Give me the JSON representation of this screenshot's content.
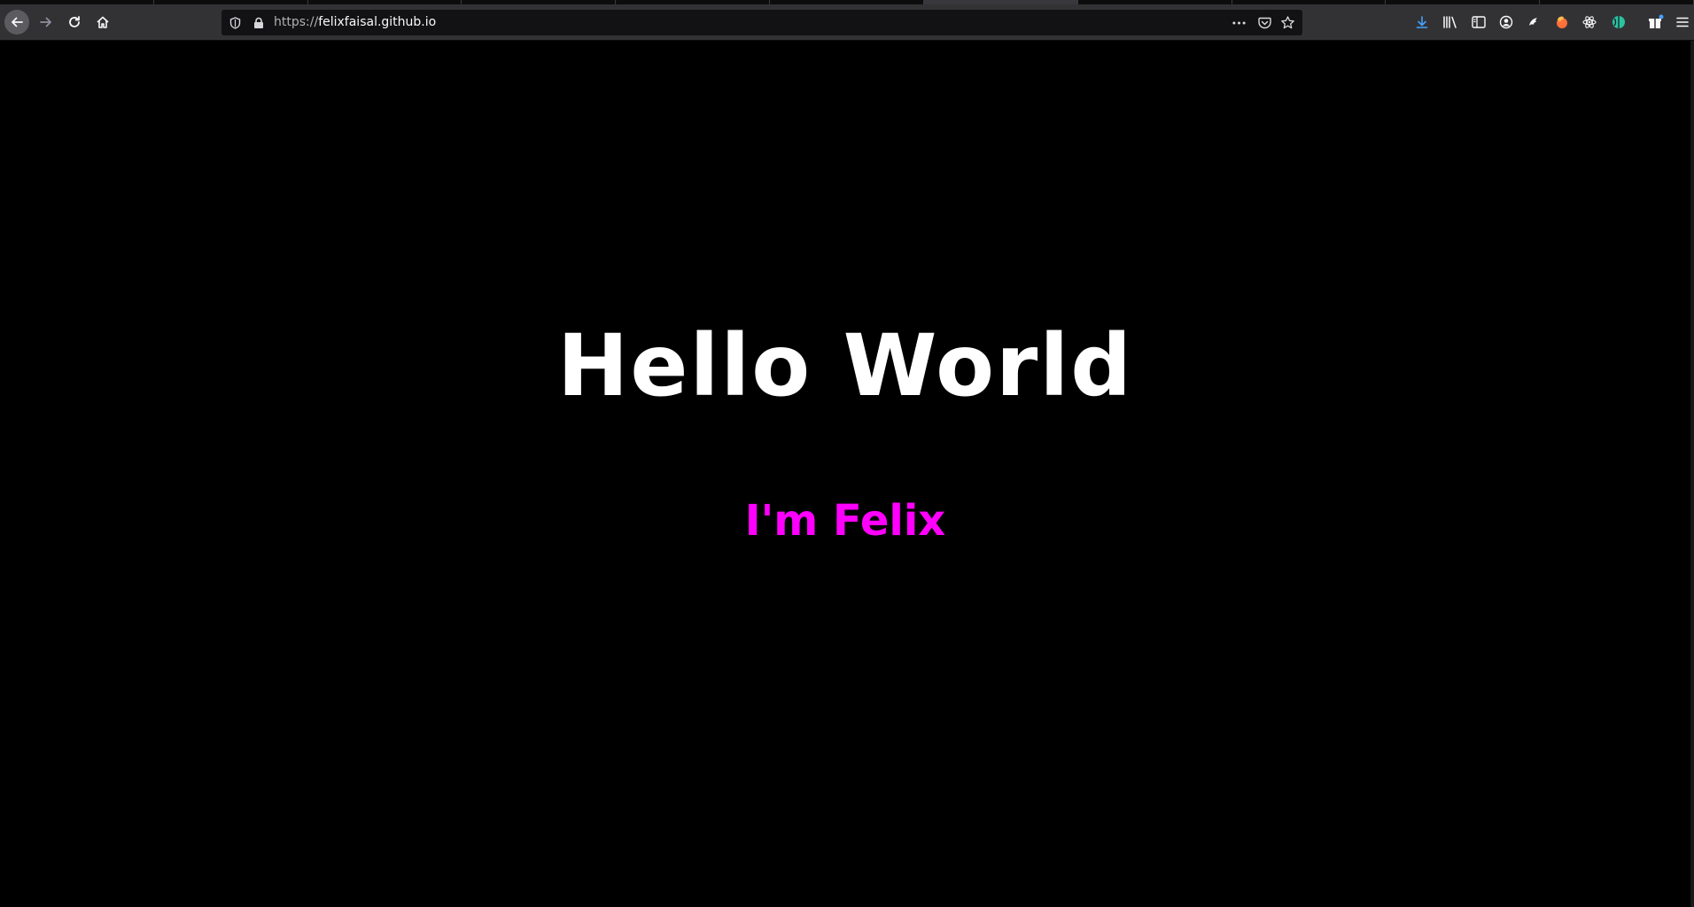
{
  "browser": {
    "url_protocol": "https://",
    "url_host": "felixfaisal.github.io",
    "icons": {
      "back": "back-arrow-icon",
      "forward": "forward-arrow-icon",
      "reload": "reload-icon",
      "home": "home-icon",
      "tracking": "shield-icon",
      "lock": "lock-icon",
      "page_actions": "more-icon",
      "pocket": "pocket-icon",
      "bookmark": "star-icon",
      "downloads": "download-icon",
      "library": "library-icon",
      "sidebar": "sidebar-icon",
      "account": "account-icon",
      "extensions": [
        "extension-icon",
        "firefox-icon",
        "react-icon",
        "globe-icon",
        "gift-icon"
      ],
      "menu": "hamburger-menu-icon"
    }
  },
  "page": {
    "title": "Hello World",
    "subtitle": "I'm Felix",
    "colors": {
      "background": "#000000",
      "title": "#ffffff",
      "subtitle": "#ff00ff"
    }
  }
}
